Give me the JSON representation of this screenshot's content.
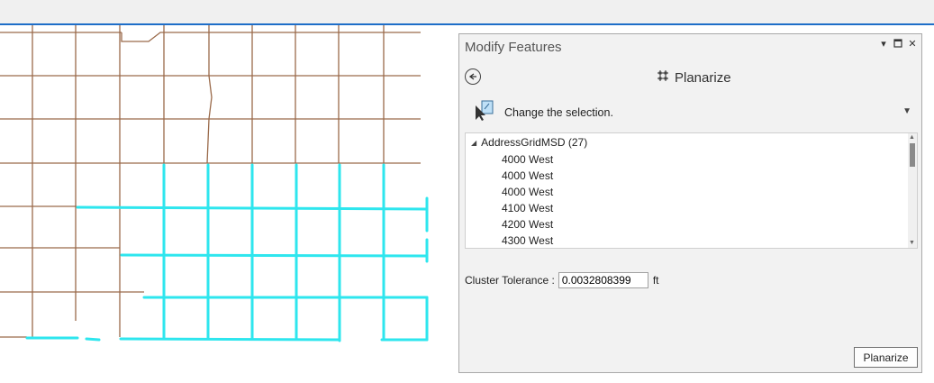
{
  "pane": {
    "title": "Modify Features",
    "tool_title": "Planarize",
    "selection_hint": "Change the selection.",
    "layer": "AddressGridMSD (27)",
    "features": [
      "4000 West",
      "4000 West",
      "4000 West",
      "4100 West",
      "4200 West",
      "4300 West"
    ],
    "cluster_label": "Cluster Tolerance :",
    "cluster_value": "0.0032808399",
    "cluster_unit": "ft",
    "run_label": "Planarize"
  },
  "colors": {
    "road": "#9a6a4a",
    "selected": "#2ee6ee",
    "accent": "#1e6ec8"
  },
  "icons": {
    "back": "back-arrow-icon",
    "tool": "planarize-icon",
    "selection": "selection-cursor-icon"
  }
}
